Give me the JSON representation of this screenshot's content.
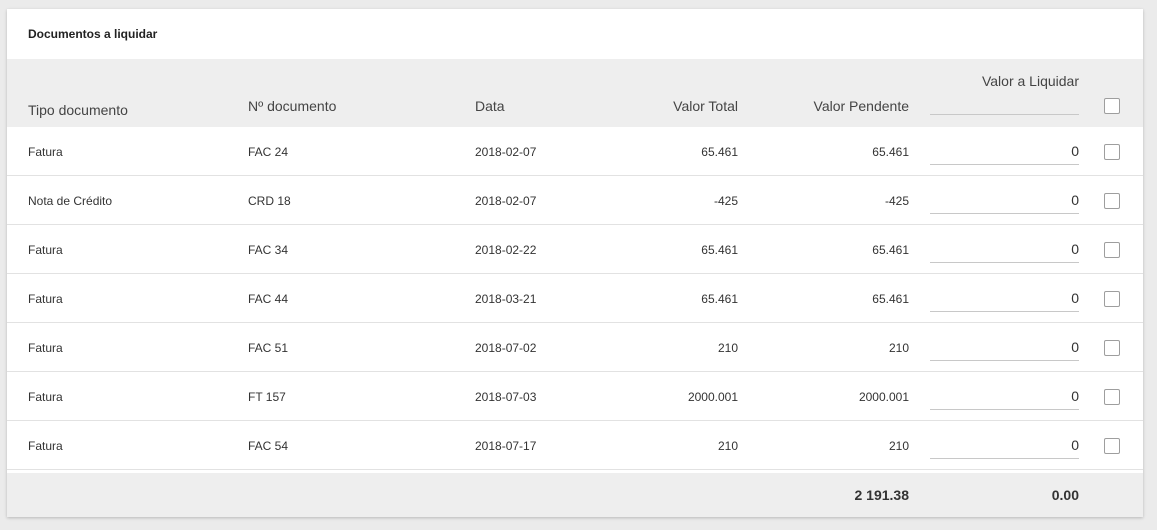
{
  "panel": {
    "title": "Documentos a liquidar"
  },
  "columns": {
    "tipo": "Tipo documento",
    "numero": "Nº documento",
    "data": "Data",
    "valor_total": "Valor Total",
    "valor_pendente": "Valor Pendente",
    "valor_liquidar": "Valor a Liquidar"
  },
  "rows": [
    {
      "tipo": "Fatura",
      "numero": "FAC 24",
      "data": "2018-02-07",
      "valor_total": "65.461",
      "valor_pendente": "65.461",
      "valor_liquidar": "0",
      "checked": false
    },
    {
      "tipo": "Nota de Crédito",
      "numero": "CRD 18",
      "data": "2018-02-07",
      "valor_total": "-425",
      "valor_pendente": "-425",
      "valor_liquidar": "0",
      "checked": false
    },
    {
      "tipo": "Fatura",
      "numero": "FAC 34",
      "data": "2018-02-22",
      "valor_total": "65.461",
      "valor_pendente": "65.461",
      "valor_liquidar": "0",
      "checked": false
    },
    {
      "tipo": "Fatura",
      "numero": "FAC 44",
      "data": "2018-03-21",
      "valor_total": "65.461",
      "valor_pendente": "65.461",
      "valor_liquidar": "0",
      "checked": false
    },
    {
      "tipo": "Fatura",
      "numero": "FAC 51",
      "data": "2018-07-02",
      "valor_total": "210",
      "valor_pendente": "210",
      "valor_liquidar": "0",
      "checked": false
    },
    {
      "tipo": "Fatura",
      "numero": "FT 157",
      "data": "2018-07-03",
      "valor_total": "2000.001",
      "valor_pendente": "2000.001",
      "valor_liquidar": "0",
      "checked": false
    },
    {
      "tipo": "Fatura",
      "numero": "FAC 54",
      "data": "2018-07-17",
      "valor_total": "210",
      "valor_pendente": "210",
      "valor_liquidar": "0",
      "checked": false
    }
  ],
  "totals": {
    "valor_pendente": "2 191.38",
    "valor_liquidar": "0.00"
  },
  "header_select_all": {
    "checked": false
  }
}
